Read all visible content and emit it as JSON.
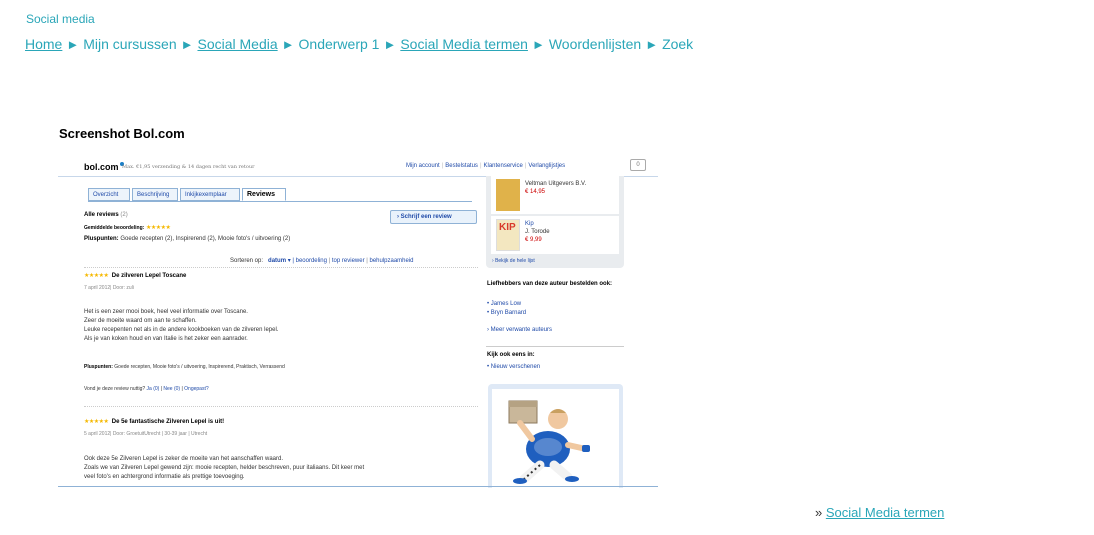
{
  "site": {
    "title": "Social media"
  },
  "breadcrumb": {
    "separator": "►",
    "items": [
      {
        "label": "Home",
        "link": true
      },
      {
        "label": "Mijn cursussen",
        "link": false
      },
      {
        "label": "Social Media",
        "link": true
      },
      {
        "label": "Onderwerp 1",
        "link": false
      },
      {
        "label": "Social Media termen",
        "link": true
      },
      {
        "label": "Woordenlijsten",
        "link": false
      },
      {
        "label": "Zoek",
        "link": false
      }
    ]
  },
  "article": {
    "title": "Screenshot Bol.com"
  },
  "screenshot": {
    "logo": "bol.com",
    "tagline": "Max. €1,95 verzending & 14 dagen recht van retour",
    "toplinks": [
      "Mijn account",
      "Bestelstatus",
      "Klantenservice",
      "Verlanglijstjes"
    ],
    "cart_count": "0",
    "tabs": [
      "Overzicht",
      "Beschrijving",
      "Inkijkexemplaar",
      "Reviews"
    ],
    "all_reviews_label": "Alle reviews",
    "all_reviews_count": "(2)",
    "write_review": "Schrijf een review",
    "avg_rating_label": "Gemiddelde beoordeling:",
    "pros_label": "Pluspunten:",
    "pros_value": "Goede recepten (2), Inspirerend (2), Mooie foto's / uitvoering (2)",
    "sort_label": "Sorteren op:",
    "sort_options": [
      "datum",
      "beoordeling",
      "top reviewer",
      "behulpzaamheid"
    ],
    "star_glyphs": "★★★★★",
    "reviews": [
      {
        "title": "De zilveren Lepel Toscane",
        "meta": "7 april 2012| Door: zuli",
        "body": [
          "Het is een zeer mooi boek, heel veel informatie over Toscane.",
          "Zeer de moeite waard om aan te schaffen.",
          "Leuke recepenten net als in de andere kookboeken van de zilveren lepel.",
          "Als je van koken houd en van Italie is het zeker een aanrader."
        ],
        "pros": "Goede recepten, Mooie foto's / uitvoering, Inspirerend, Praktisch, Verrassend",
        "useful": "Vond je deze review nuttig?",
        "yes": "Ja (0)",
        "no": "Nee (0)",
        "report": "Ongepast?"
      },
      {
        "title": "De 5e fantastische Zilveren Lepel is uit!",
        "meta": "5 april 2012| Door: GroetuitUtrecht | 30-39 jaar | Utrecht",
        "body": [
          "Ook deze 5e Zilveren Lepel is zeker de moeite van het aanschaffen waard.",
          "Zoals we van Zilveren Lepel gewend zijn: mooie recepten, helder beschreven, puur italiaans. Dit keer met",
          "veel foto's en achtergrond informatie als prettige toevoeging."
        ]
      }
    ],
    "side_books": [
      {
        "publisher": "Veltman Uitgevers B.V.",
        "price": "€ 14,95"
      },
      {
        "title": "Kip",
        "author": "J. Torode",
        "price": "€ 9,99",
        "cover_text": "KIP"
      }
    ],
    "see_list": "Bekijk de hele lijst",
    "fans_heading": "Liefhebbers van deze auteur bestelden ook:",
    "fans_authors": [
      "James Low",
      "Bryn Barnard"
    ],
    "more_authors": "Meer verwante auteurs",
    "look_heading": "Kijk ook eens in:",
    "look_link": "Nieuw verschenen"
  },
  "footer": {
    "prefix": "»",
    "link": "Social Media termen"
  }
}
